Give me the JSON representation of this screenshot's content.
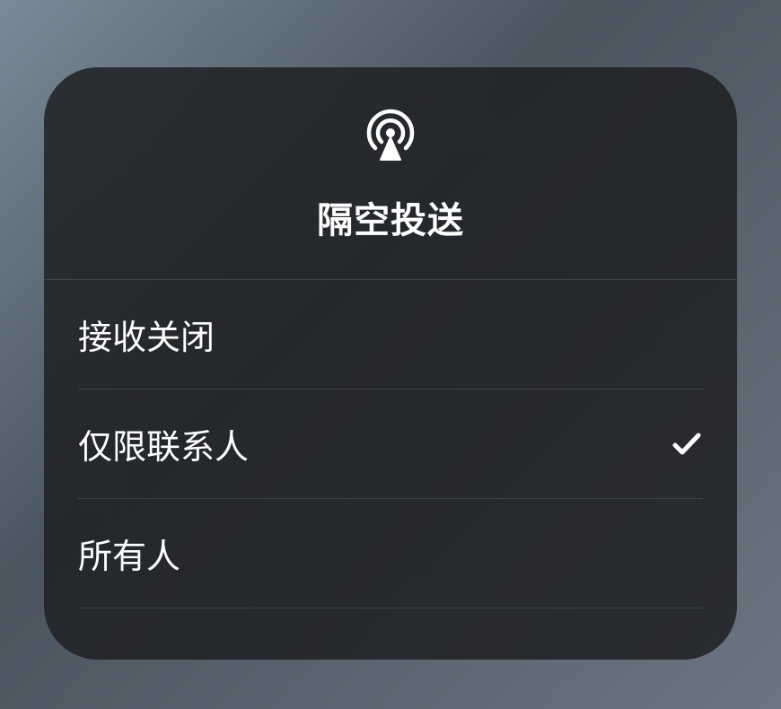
{
  "title": "隔空投送",
  "options": [
    {
      "label": "接收关闭",
      "selected": false
    },
    {
      "label": "仅限联系人",
      "selected": true
    },
    {
      "label": "所有人",
      "selected": false
    }
  ]
}
